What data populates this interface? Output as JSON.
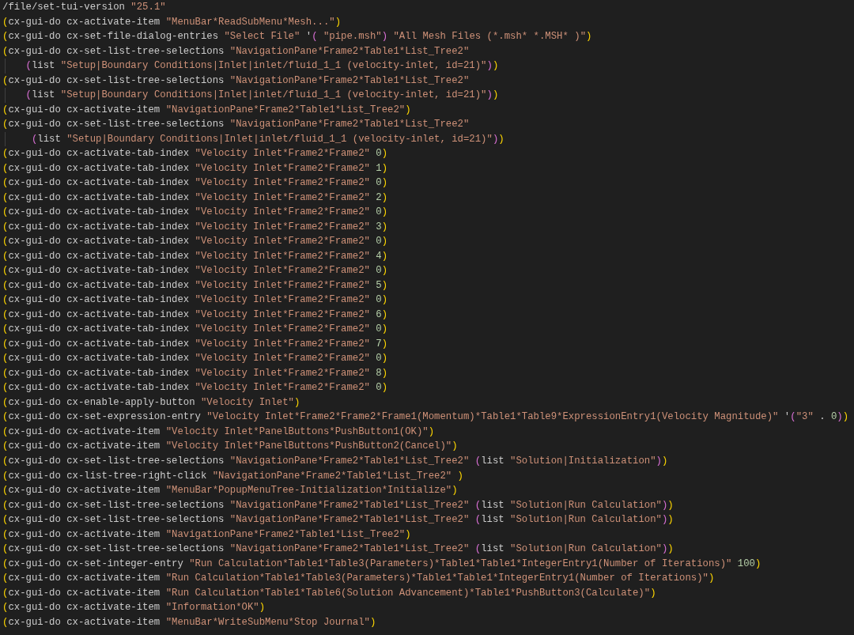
{
  "editor": {
    "lines": [
      {
        "tokens": [
          {
            "kind": "plain",
            "text": "/file/set-tui-version "
          },
          {
            "kind": "string",
            "text": "\"25.1\""
          }
        ]
      },
      {
        "tokens": [
          {
            "kind": "bracket",
            "text": "("
          },
          {
            "kind": "plain",
            "text": "cx-gui-do cx-activate-item "
          },
          {
            "kind": "string",
            "text": "\"MenuBar*ReadSubMenu*Mesh...\""
          },
          {
            "kind": "bracket",
            "text": ")"
          }
        ]
      },
      {
        "tokens": [
          {
            "kind": "bracket",
            "text": "("
          },
          {
            "kind": "plain",
            "text": "cx-gui-do cx-set-file-dialog-entries "
          },
          {
            "kind": "string",
            "text": "\"Select File\""
          },
          {
            "kind": "plain",
            "text": " '"
          },
          {
            "kind": "subbracket",
            "text": "("
          },
          {
            "kind": "string",
            "text": " \"pipe.msh\""
          },
          {
            "kind": "subbracket",
            "text": ")"
          },
          {
            "kind": "string",
            "text": " \"All Mesh Files (*.msh* *.MSH* )\""
          },
          {
            "kind": "bracket",
            "text": ")"
          }
        ]
      },
      {
        "tokens": [
          {
            "kind": "bracket",
            "text": "("
          },
          {
            "kind": "plain",
            "text": "cx-gui-do cx-set-list-tree-selections "
          },
          {
            "kind": "string",
            "text": "\"NavigationPane*Frame2*Table1*List_Tree2\""
          }
        ]
      },
      {
        "tokens": [
          {
            "kind": "subbracket",
            "text": "    ("
          },
          {
            "kind": "plain",
            "text": "list "
          },
          {
            "kind": "string",
            "text": "\"Setup|Boundary Conditions|Inlet|inlet/fluid_1_1 (velocity-inlet, id=21)\""
          },
          {
            "kind": "subbracket",
            "text": ")"
          },
          {
            "kind": "bracket",
            "text": ")"
          }
        ]
      },
      {
        "tokens": [
          {
            "kind": "bracket",
            "text": "("
          },
          {
            "kind": "plain",
            "text": "cx-gui-do cx-set-list-tree-selections "
          },
          {
            "kind": "string",
            "text": "\"NavigationPane*Frame2*Table1*List_Tree2\""
          }
        ]
      },
      {
        "tokens": [
          {
            "kind": "subbracket",
            "text": "    ("
          },
          {
            "kind": "plain",
            "text": "list "
          },
          {
            "kind": "string",
            "text": "\"Setup|Boundary Conditions|Inlet|inlet/fluid_1_1 (velocity-inlet, id=21)\""
          },
          {
            "kind": "subbracket",
            "text": ")"
          },
          {
            "kind": "bracket",
            "text": ")"
          }
        ]
      },
      {
        "tokens": [
          {
            "kind": "bracket",
            "text": "("
          },
          {
            "kind": "plain",
            "text": "cx-gui-do cx-activate-item "
          },
          {
            "kind": "string",
            "text": "\"NavigationPane*Frame2*Table1*List_Tree2\""
          },
          {
            "kind": "bracket",
            "text": ")"
          }
        ]
      },
      {
        "tokens": [
          {
            "kind": "bracket",
            "text": "("
          },
          {
            "kind": "plain",
            "text": "cx-gui-do cx-set-list-tree-selections "
          },
          {
            "kind": "string",
            "text": "\"NavigationPane*Frame2*Table1*List_Tree2\""
          }
        ]
      },
      {
        "tokens": [
          {
            "kind": "subbracket",
            "text": "     ("
          },
          {
            "kind": "plain",
            "text": "list "
          },
          {
            "kind": "string",
            "text": "\"Setup|Boundary Conditions|Inlet|inlet/fluid_1_1 (velocity-inlet, id=21)\""
          },
          {
            "kind": "subbracket",
            "text": ")"
          },
          {
            "kind": "bracket",
            "text": ")"
          }
        ]
      },
      {
        "tokens": [
          {
            "kind": "bracket",
            "text": "("
          },
          {
            "kind": "plain",
            "text": "cx-gui-do cx-activate-tab-index "
          },
          {
            "kind": "string",
            "text": "\"Velocity Inlet*Frame2*Frame2\""
          },
          {
            "kind": "number",
            "text": " 0"
          },
          {
            "kind": "bracket",
            "text": ")"
          }
        ]
      },
      {
        "tokens": [
          {
            "kind": "bracket",
            "text": "("
          },
          {
            "kind": "plain",
            "text": "cx-gui-do cx-activate-tab-index "
          },
          {
            "kind": "string",
            "text": "\"Velocity Inlet*Frame2*Frame2\""
          },
          {
            "kind": "number",
            "text": " 1"
          },
          {
            "kind": "bracket",
            "text": ")"
          }
        ]
      },
      {
        "tokens": [
          {
            "kind": "bracket",
            "text": "("
          },
          {
            "kind": "plain",
            "text": "cx-gui-do cx-activate-tab-index "
          },
          {
            "kind": "string",
            "text": "\"Velocity Inlet*Frame2*Frame2\""
          },
          {
            "kind": "number",
            "text": " 0"
          },
          {
            "kind": "bracket",
            "text": ")"
          }
        ]
      },
      {
        "tokens": [
          {
            "kind": "bracket",
            "text": "("
          },
          {
            "kind": "plain",
            "text": "cx-gui-do cx-activate-tab-index "
          },
          {
            "kind": "string",
            "text": "\"Velocity Inlet*Frame2*Frame2\""
          },
          {
            "kind": "number",
            "text": " 2"
          },
          {
            "kind": "bracket",
            "text": ")"
          }
        ]
      },
      {
        "tokens": [
          {
            "kind": "bracket",
            "text": "("
          },
          {
            "kind": "plain",
            "text": "cx-gui-do cx-activate-tab-index "
          },
          {
            "kind": "string",
            "text": "\"Velocity Inlet*Frame2*Frame2\""
          },
          {
            "kind": "number",
            "text": " 0"
          },
          {
            "kind": "bracket",
            "text": ")"
          }
        ]
      },
      {
        "tokens": [
          {
            "kind": "bracket",
            "text": "("
          },
          {
            "kind": "plain",
            "text": "cx-gui-do cx-activate-tab-index "
          },
          {
            "kind": "string",
            "text": "\"Velocity Inlet*Frame2*Frame2\""
          },
          {
            "kind": "number",
            "text": " 3"
          },
          {
            "kind": "bracket",
            "text": ")"
          }
        ]
      },
      {
        "tokens": [
          {
            "kind": "bracket",
            "text": "("
          },
          {
            "kind": "plain",
            "text": "cx-gui-do cx-activate-tab-index "
          },
          {
            "kind": "string",
            "text": "\"Velocity Inlet*Frame2*Frame2\""
          },
          {
            "kind": "number",
            "text": " 0"
          },
          {
            "kind": "bracket",
            "text": ")"
          }
        ]
      },
      {
        "tokens": [
          {
            "kind": "bracket",
            "text": "("
          },
          {
            "kind": "plain",
            "text": "cx-gui-do cx-activate-tab-index "
          },
          {
            "kind": "string",
            "text": "\"Velocity Inlet*Frame2*Frame2\""
          },
          {
            "kind": "number",
            "text": " 4"
          },
          {
            "kind": "bracket",
            "text": ")"
          }
        ]
      },
      {
        "tokens": [
          {
            "kind": "bracket",
            "text": "("
          },
          {
            "kind": "plain",
            "text": "cx-gui-do cx-activate-tab-index "
          },
          {
            "kind": "string",
            "text": "\"Velocity Inlet*Frame2*Frame2\""
          },
          {
            "kind": "number",
            "text": " 0"
          },
          {
            "kind": "bracket",
            "text": ")"
          }
        ]
      },
      {
        "tokens": [
          {
            "kind": "bracket",
            "text": "("
          },
          {
            "kind": "plain",
            "text": "cx-gui-do cx-activate-tab-index "
          },
          {
            "kind": "string",
            "text": "\"Velocity Inlet*Frame2*Frame2\""
          },
          {
            "kind": "number",
            "text": " 5"
          },
          {
            "kind": "bracket",
            "text": ")"
          }
        ]
      },
      {
        "tokens": [
          {
            "kind": "bracket",
            "text": "("
          },
          {
            "kind": "plain",
            "text": "cx-gui-do cx-activate-tab-index "
          },
          {
            "kind": "string",
            "text": "\"Velocity Inlet*Frame2*Frame2\""
          },
          {
            "kind": "number",
            "text": " 0"
          },
          {
            "kind": "bracket",
            "text": ")"
          }
        ]
      },
      {
        "tokens": [
          {
            "kind": "bracket",
            "text": "("
          },
          {
            "kind": "plain",
            "text": "cx-gui-do cx-activate-tab-index "
          },
          {
            "kind": "string",
            "text": "\"Velocity Inlet*Frame2*Frame2\""
          },
          {
            "kind": "number",
            "text": " 6"
          },
          {
            "kind": "bracket",
            "text": ")"
          }
        ]
      },
      {
        "tokens": [
          {
            "kind": "bracket",
            "text": "("
          },
          {
            "kind": "plain",
            "text": "cx-gui-do cx-activate-tab-index "
          },
          {
            "kind": "string",
            "text": "\"Velocity Inlet*Frame2*Frame2\""
          },
          {
            "kind": "number",
            "text": " 0"
          },
          {
            "kind": "bracket",
            "text": ")"
          }
        ]
      },
      {
        "tokens": [
          {
            "kind": "bracket",
            "text": "("
          },
          {
            "kind": "plain",
            "text": "cx-gui-do cx-activate-tab-index "
          },
          {
            "kind": "string",
            "text": "\"Velocity Inlet*Frame2*Frame2\""
          },
          {
            "kind": "number",
            "text": " 7"
          },
          {
            "kind": "bracket",
            "text": ")"
          }
        ]
      },
      {
        "tokens": [
          {
            "kind": "bracket",
            "text": "("
          },
          {
            "kind": "plain",
            "text": "cx-gui-do cx-activate-tab-index "
          },
          {
            "kind": "string",
            "text": "\"Velocity Inlet*Frame2*Frame2\""
          },
          {
            "kind": "number",
            "text": " 0"
          },
          {
            "kind": "bracket",
            "text": ")"
          }
        ]
      },
      {
        "tokens": [
          {
            "kind": "bracket",
            "text": "("
          },
          {
            "kind": "plain",
            "text": "cx-gui-do cx-activate-tab-index "
          },
          {
            "kind": "string",
            "text": "\"Velocity Inlet*Frame2*Frame2\""
          },
          {
            "kind": "number",
            "text": " 8"
          },
          {
            "kind": "bracket",
            "text": ")"
          }
        ]
      },
      {
        "tokens": [
          {
            "kind": "bracket",
            "text": "("
          },
          {
            "kind": "plain",
            "text": "cx-gui-do cx-activate-tab-index "
          },
          {
            "kind": "string",
            "text": "\"Velocity Inlet*Frame2*Frame2\""
          },
          {
            "kind": "number",
            "text": " 0"
          },
          {
            "kind": "bracket",
            "text": ")"
          }
        ]
      },
      {
        "tokens": [
          {
            "kind": "bracket",
            "text": "("
          },
          {
            "kind": "plain",
            "text": "cx-gui-do cx-enable-apply-button "
          },
          {
            "kind": "string",
            "text": "\"Velocity Inlet\""
          },
          {
            "kind": "bracket",
            "text": ")"
          }
        ]
      },
      {
        "tokens": [
          {
            "kind": "bracket",
            "text": "("
          },
          {
            "kind": "plain",
            "text": "cx-gui-do cx-set-expression-entry "
          },
          {
            "kind": "string",
            "text": "\"Velocity Inlet*Frame2*Frame2*Frame1(Momentum)*Table1*Table9*ExpressionEntry1(Velocity Magnitude)\""
          },
          {
            "kind": "plain",
            "text": " '"
          },
          {
            "kind": "subbracket",
            "text": "("
          },
          {
            "kind": "string",
            "text": "\"3\""
          },
          {
            "kind": "plain",
            "text": " . "
          },
          {
            "kind": "number",
            "text": "0"
          },
          {
            "kind": "subbracket",
            "text": ")"
          },
          {
            "kind": "bracket",
            "text": ")"
          }
        ]
      },
      {
        "tokens": [
          {
            "kind": "bracket",
            "text": "("
          },
          {
            "kind": "plain",
            "text": "cx-gui-do cx-activate-item "
          },
          {
            "kind": "string",
            "text": "\"Velocity Inlet*PanelButtons*PushButton1(OK)\""
          },
          {
            "kind": "bracket",
            "text": ")"
          }
        ]
      },
      {
        "tokens": [
          {
            "kind": "bracket",
            "text": "("
          },
          {
            "kind": "plain",
            "text": "cx-gui-do cx-activate-item "
          },
          {
            "kind": "string",
            "text": "\"Velocity Inlet*PanelButtons*PushButton2(Cancel)\""
          },
          {
            "kind": "bracket",
            "text": ")"
          }
        ]
      },
      {
        "tokens": [
          {
            "kind": "bracket",
            "text": "("
          },
          {
            "kind": "plain",
            "text": "cx-gui-do cx-set-list-tree-selections "
          },
          {
            "kind": "string",
            "text": "\"NavigationPane*Frame2*Table1*List_Tree2\""
          },
          {
            "kind": "subbracket",
            "text": " ("
          },
          {
            "kind": "plain",
            "text": "list "
          },
          {
            "kind": "string",
            "text": "\"Solution|Initialization\""
          },
          {
            "kind": "subbracket",
            "text": ")"
          },
          {
            "kind": "bracket",
            "text": ")"
          }
        ]
      },
      {
        "tokens": [
          {
            "kind": "bracket",
            "text": "("
          },
          {
            "kind": "plain",
            "text": "cx-gui-do cx-list-tree-right-click "
          },
          {
            "kind": "string",
            "text": "\"NavigationPane*Frame2*Table1*List_Tree2\""
          },
          {
            "kind": "bracket",
            "text": " )"
          }
        ]
      },
      {
        "tokens": [
          {
            "kind": "bracket",
            "text": "("
          },
          {
            "kind": "plain",
            "text": "cx-gui-do cx-activate-item "
          },
          {
            "kind": "string",
            "text": "\"MenuBar*PopupMenuTree-Initialization*Initialize\""
          },
          {
            "kind": "bracket",
            "text": ")"
          }
        ]
      },
      {
        "tokens": [
          {
            "kind": "bracket",
            "text": "("
          },
          {
            "kind": "plain",
            "text": "cx-gui-do cx-set-list-tree-selections "
          },
          {
            "kind": "string",
            "text": "\"NavigationPane*Frame2*Table1*List_Tree2\""
          },
          {
            "kind": "subbracket",
            "text": " ("
          },
          {
            "kind": "plain",
            "text": "list "
          },
          {
            "kind": "string",
            "text": "\"Solution|Run Calculation\""
          },
          {
            "kind": "subbracket",
            "text": ")"
          },
          {
            "kind": "bracket",
            "text": ")"
          }
        ]
      },
      {
        "tokens": [
          {
            "kind": "bracket",
            "text": "("
          },
          {
            "kind": "plain",
            "text": "cx-gui-do cx-set-list-tree-selections "
          },
          {
            "kind": "string",
            "text": "\"NavigationPane*Frame2*Table1*List_Tree2\""
          },
          {
            "kind": "subbracket",
            "text": " ("
          },
          {
            "kind": "plain",
            "text": "list "
          },
          {
            "kind": "string",
            "text": "\"Solution|Run Calculation\""
          },
          {
            "kind": "subbracket",
            "text": ")"
          },
          {
            "kind": "bracket",
            "text": ")"
          }
        ]
      },
      {
        "tokens": [
          {
            "kind": "bracket",
            "text": "("
          },
          {
            "kind": "plain",
            "text": "cx-gui-do cx-activate-item "
          },
          {
            "kind": "string",
            "text": "\"NavigationPane*Frame2*Table1*List_Tree2\""
          },
          {
            "kind": "bracket",
            "text": ")"
          }
        ]
      },
      {
        "tokens": [
          {
            "kind": "bracket",
            "text": "("
          },
          {
            "kind": "plain",
            "text": "cx-gui-do cx-set-list-tree-selections "
          },
          {
            "kind": "string",
            "text": "\"NavigationPane*Frame2*Table1*List_Tree2\""
          },
          {
            "kind": "subbracket",
            "text": " ("
          },
          {
            "kind": "plain",
            "text": "list "
          },
          {
            "kind": "string",
            "text": "\"Solution|Run Calculation\""
          },
          {
            "kind": "subbracket",
            "text": ")"
          },
          {
            "kind": "bracket",
            "text": ")"
          }
        ]
      },
      {
        "tokens": [
          {
            "kind": "bracket",
            "text": "("
          },
          {
            "kind": "plain",
            "text": "cx-gui-do cx-set-integer-entry "
          },
          {
            "kind": "string",
            "text": "\"Run Calculation*Table1*Table3(Parameters)*Table1*Table1*IntegerEntry1(Number of Iterations)\""
          },
          {
            "kind": "number",
            "text": " 100"
          },
          {
            "kind": "bracket",
            "text": ")"
          }
        ]
      },
      {
        "tokens": [
          {
            "kind": "bracket",
            "text": "("
          },
          {
            "kind": "plain",
            "text": "cx-gui-do cx-activate-item "
          },
          {
            "kind": "string",
            "text": "\"Run Calculation*Table1*Table3(Parameters)*Table1*Table1*IntegerEntry1(Number of Iterations)\""
          },
          {
            "kind": "bracket",
            "text": ")"
          }
        ]
      },
      {
        "tokens": [
          {
            "kind": "bracket",
            "text": "("
          },
          {
            "kind": "plain",
            "text": "cx-gui-do cx-activate-item "
          },
          {
            "kind": "string",
            "text": "\"Run Calculation*Table1*Table6(Solution Advancement)*Table1*PushButton3(Calculate)\""
          },
          {
            "kind": "bracket",
            "text": ")"
          }
        ]
      },
      {
        "tokens": [
          {
            "kind": "bracket",
            "text": "("
          },
          {
            "kind": "plain",
            "text": "cx-gui-do cx-activate-item "
          },
          {
            "kind": "string",
            "text": "\"Information*OK\""
          },
          {
            "kind": "bracket",
            "text": ")"
          }
        ]
      },
      {
        "tokens": [
          {
            "kind": "bracket",
            "text": "("
          },
          {
            "kind": "plain",
            "text": "cx-gui-do cx-activate-item "
          },
          {
            "kind": "string",
            "text": "\"MenuBar*WriteSubMenu*Stop Journal\""
          },
          {
            "kind": "bracket",
            "text": ")"
          }
        ]
      }
    ]
  }
}
